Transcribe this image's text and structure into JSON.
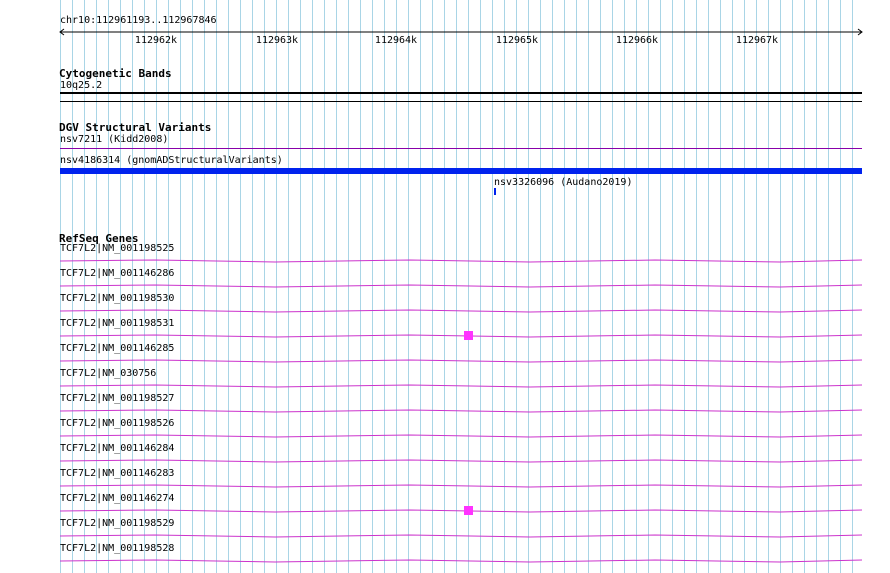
{
  "ruler": {
    "location": "chr10:112961193..112967846",
    "ticks": [
      "112962k",
      "112963k",
      "112964k",
      "112965k",
      "112966k",
      "112967k"
    ]
  },
  "tracks": {
    "cytoband": {
      "title": "Cytogenetic Bands",
      "features": [
        {
          "label": "10q25.2"
        }
      ]
    },
    "dgv": {
      "title": "DGV Structural Variants",
      "features": [
        {
          "label": "nsv7211 (Kidd2008)"
        },
        {
          "label": "nsv4186314 (gnomADStructuralVariants)"
        },
        {
          "label": "nsv3326096 (Audano2019)"
        }
      ]
    },
    "refseq": {
      "title": "RefSeq Genes",
      "features": [
        {
          "label": "TCF7L2|NM_001198525"
        },
        {
          "label": "TCF7L2|NM_001146286"
        },
        {
          "label": "TCF7L2|NM_001198530"
        },
        {
          "label": "TCF7L2|NM_001198531"
        },
        {
          "label": "TCF7L2|NM_001146285"
        },
        {
          "label": "TCF7L2|NM_030756"
        },
        {
          "label": "TCF7L2|NM_001198527"
        },
        {
          "label": "TCF7L2|NM_001198526"
        },
        {
          "label": "TCF7L2|NM_001146284"
        },
        {
          "label": "TCF7L2|NM_001146283"
        },
        {
          "label": "TCF7L2|NM_001146274"
        },
        {
          "label": "TCF7L2|NM_001198529"
        },
        {
          "label": "TCF7L2|NM_001198528"
        }
      ]
    }
  },
  "colors": {
    "grid": "#a9d5e6",
    "intron": "#cc33cc",
    "exon": "#ff33ff",
    "sv_bar": "#0022ee",
    "sv_line": "#8800aa",
    "text": "#000000"
  }
}
